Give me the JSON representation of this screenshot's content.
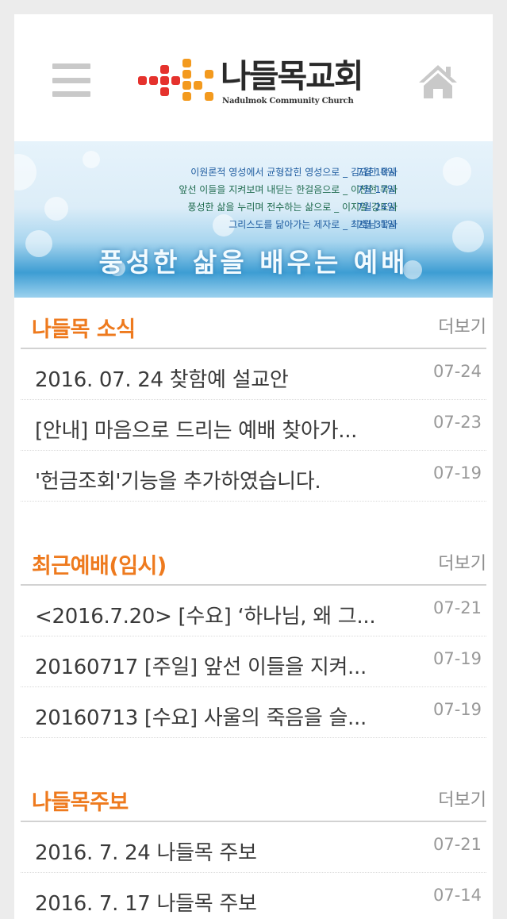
{
  "header": {
    "logo_title": "나들목교회",
    "logo_subtitle": "Nadulmok Community Church",
    "menu_icon": "hamburger-menu-icon",
    "home_icon": "home-icon"
  },
  "banner": {
    "lines": [
      {
        "text": "이원론적 영성에서 균형잡힌 영성으로 _ 김요한 목사",
        "date": "7월 10일"
      },
      {
        "text": "앞선 이들을 지켜보며 내딛는 한걸음으로 _ 이찬현 목사",
        "date": "7월 17일"
      },
      {
        "text": "풍성한 삶을 누리며 전수하는 삶으로 _ 이지일 강도사",
        "date": "7월 24일"
      },
      {
        "text": "그리스도를 닮아가는 제자로 _ 최호남 목사",
        "date": "7월 31일"
      }
    ],
    "title": "풍성한 삶을 배우는 예배"
  },
  "sections": [
    {
      "title": "나들목 소식",
      "more": "더보기",
      "items": [
        {
          "title": "2016. 07. 24 찾함예 설교안",
          "date": "07-24"
        },
        {
          "title": "[안내] 마음으로 드리는 예배 찾아가...",
          "date": "07-23"
        },
        {
          "title": "'헌금조회'기능을 추가하였습니다.",
          "date": "07-19"
        }
      ]
    },
    {
      "title": "최근예배(임시)",
      "more": "더보기",
      "items": [
        {
          "title": "<2016.7.20> [수요] ‘하나님, 왜 그...",
          "date": "07-21"
        },
        {
          "title": "20160717 [주일] 앞선 이들을 지켜...",
          "date": "07-19"
        },
        {
          "title": "20160713 [수요] 사울의 죽음을 슬...",
          "date": "07-19"
        }
      ]
    },
    {
      "title": "나들목주보",
      "more": "더보기",
      "items": [
        {
          "title": "2016. 7. 24 나들목 주보",
          "date": "07-21"
        },
        {
          "title": "2016. 7. 17 나들목 주보",
          "date": "07-14"
        }
      ]
    }
  ],
  "colors": {
    "accent": "#ee7a1e",
    "logo_orange": "#f39a1e",
    "logo_red": "#e5322d",
    "banner_text": "#1f5da0"
  }
}
